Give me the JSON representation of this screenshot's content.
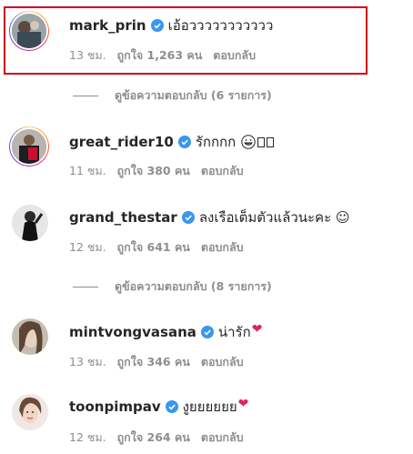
{
  "comments": [
    {
      "username": "mark_prin",
      "text": "เอ้อววววววววววว",
      "time": "13 ชม.",
      "likes": "ถูกใจ 1,263 คน",
      "reply": "ตอบกลับ",
      "avatar": "avatar-mark-prin"
    },
    {
      "username": "great_rider10",
      "text": "รักกกก",
      "emoji": "grinning-face-emoji",
      "time": "11 ชม.",
      "likes": "ถูกใจ 380 คน",
      "reply": "ตอบกลับ",
      "avatar": "avatar-great-rider10"
    },
    {
      "username": "grand_thestar",
      "text": "ลงเรือเต็มตัวแล้วนะคะ ☺",
      "time": "12 ชม.",
      "likes": "ถูกใจ 641 คน",
      "reply": "ตอบกลับ",
      "avatar": "avatar-grand-thestar"
    },
    {
      "username": "mintvongvasana",
      "text": "น่ารัก",
      "emoji": "red-heart-emoji",
      "time": "13 ชม.",
      "likes": "ถูกใจ 346 คน",
      "reply": "ตอบกลับ",
      "avatar": "avatar-mintvongvasana"
    },
    {
      "username": "toonpimpav",
      "text": "งูยยยยยย",
      "emoji": "red-heart-emoji",
      "time": "12 ชม.",
      "likes": "ถูกใจ 264 คน",
      "reply": "ตอบกลับ",
      "avatar": "avatar-toonpimpav"
    }
  ],
  "view_replies": [
    "ดูข้อความตอบกลับ (6 รายการ)",
    "ดูข้อความตอบกลับ (8 รายการ)"
  ],
  "colors": {
    "verified_badge": "#3897f0",
    "highlight_border": "#d0021b",
    "muted_text": "#8e8e8e",
    "primary_text": "#262626",
    "heart": "#e0245e"
  }
}
